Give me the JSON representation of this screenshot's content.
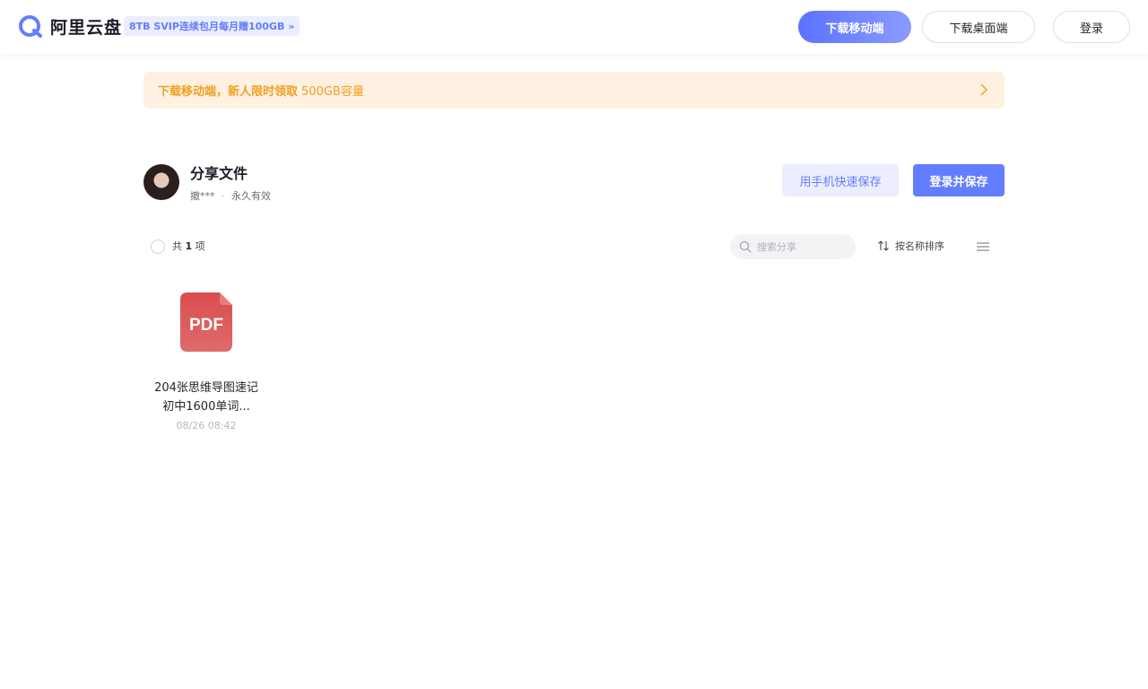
{
  "header": {
    "logo_text": "阿里云盘",
    "promo": "8TB SVIP连续包月每月赠100GB",
    "download_mobile": "下载移动端",
    "download_desktop": "下载桌面端",
    "login": "登录"
  },
  "banner": {
    "text": "下载移动端，新人限时领取",
    "highlight": "500GB容量"
  },
  "share": {
    "title": "分享文件",
    "owner": "撤***",
    "separator": "·",
    "validity": "永久有效",
    "phone_save": "用手机快速保存",
    "login_save": "登录并保存"
  },
  "toolbar": {
    "count_prefix": "共",
    "count_value": "1",
    "count_suffix": "项",
    "search_placeholder": "搜索分享",
    "sort_label": "按名称排序"
  },
  "files": [
    {
      "type_label": "PDF",
      "name": "204张思维导图速记初中1600单词...",
      "date": "08/26 08:42",
      "icon": "pdf-icon"
    }
  ],
  "colors": {
    "accent": "#637dff",
    "banner_bg": "#fff1e2",
    "banner_text": "#f0a020",
    "pdf_red": "#d94e4e"
  }
}
